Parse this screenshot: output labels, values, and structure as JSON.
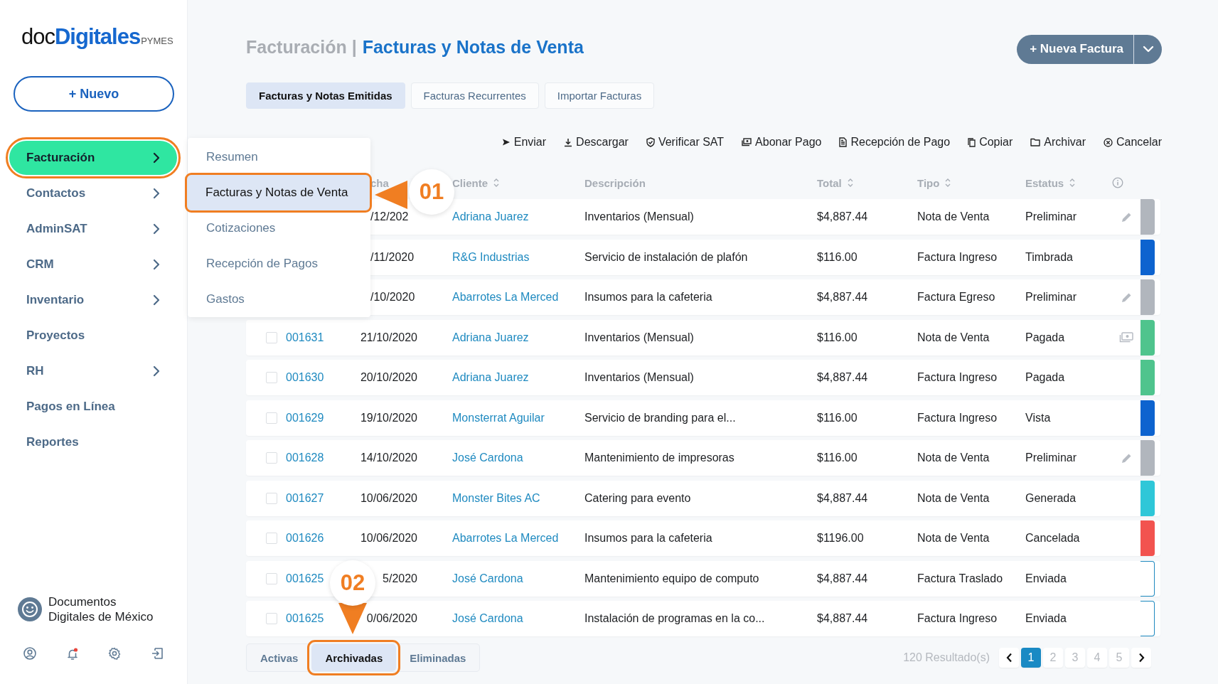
{
  "logo": {
    "prefix": "doc",
    "name": "Digitales",
    "suffix": "PYMES"
  },
  "new_button": {
    "label": "+ Nuevo"
  },
  "sidebar": {
    "items": [
      {
        "label": "Facturación",
        "selected": true,
        "highlighted": true,
        "submenu": true
      },
      {
        "label": "Contactos",
        "selected": false,
        "highlighted": false,
        "submenu": true
      },
      {
        "label": "AdminSAT",
        "selected": false,
        "highlighted": false,
        "submenu": true
      },
      {
        "label": "CRM",
        "selected": false,
        "highlighted": false,
        "submenu": true
      },
      {
        "label": "Inventario",
        "selected": false,
        "highlighted": false,
        "submenu": true
      },
      {
        "label": "Proyectos",
        "selected": false,
        "highlighted": false,
        "submenu": false
      },
      {
        "label": "RH",
        "selected": false,
        "highlighted": false,
        "submenu": true
      },
      {
        "label": "Pagos en Línea",
        "selected": false,
        "highlighted": false,
        "submenu": false
      },
      {
        "label": "Reportes",
        "selected": false,
        "highlighted": false,
        "submenu": false
      }
    ],
    "company": "Documentos Digitales de México",
    "footer_icons": [
      {
        "kind": "user"
      },
      {
        "kind": "bell",
        "alert": true
      },
      {
        "kind": "settings"
      },
      {
        "kind": "logout"
      }
    ]
  },
  "submenu": {
    "items": [
      {
        "label": "Resumen",
        "selected": false,
        "highlighted": false
      },
      {
        "label": "Facturas y Notas de Venta",
        "selected": true,
        "highlighted": true
      },
      {
        "label": "Cotizaciones",
        "selected": false,
        "highlighted": false
      },
      {
        "label": "Recepción de Pagos",
        "selected": false,
        "highlighted": false
      },
      {
        "label": "Gastos",
        "selected": false,
        "highlighted": false
      }
    ]
  },
  "header": {
    "section": "Facturación |",
    "page": "Facturas y Notas de Venta",
    "primary_button": "+ Nueva Factura"
  },
  "tabs": [
    {
      "label": "Facturas y Notas Emitidas",
      "selected": true
    },
    {
      "label": "Facturas Recurrentes",
      "selected": false
    },
    {
      "label": "Importar Facturas",
      "selected": false
    }
  ],
  "toolbar": [
    {
      "label": "Enviar",
      "kind": "send"
    },
    {
      "label": "Descargar",
      "kind": "download"
    },
    {
      "label": "Verificar SAT",
      "kind": "shield"
    },
    {
      "label": "Abonar Pago",
      "kind": "money"
    },
    {
      "label": "Recepción de Pago",
      "kind": "document"
    },
    {
      "label": "Copiar",
      "kind": "copy"
    },
    {
      "label": "Archivar",
      "kind": "folder"
    },
    {
      "label": "Cancelar",
      "kind": "cancel"
    }
  ],
  "table": {
    "columns": [
      {
        "label": "cha",
        "sortable": false,
        "covered": true
      },
      {
        "label": "Cliente",
        "sortable": true,
        "covered": false
      },
      {
        "label": "Descripción",
        "sortable": false,
        "covered": false
      },
      {
        "label": "Total",
        "sortable": true,
        "covered": false
      },
      {
        "label": "Tipo",
        "sortable": true,
        "covered": false
      },
      {
        "label": "Estatus",
        "sortable": true,
        "covered": false
      }
    ],
    "rows": [
      {
        "date": "/12/202",
        "client": "Adriana Juarez",
        "description": "Inventarios (Mensual)",
        "total": "$4,887.44",
        "type": "Nota de Venta",
        "status": "Preliminar",
        "kind": "editable",
        "color": "#b1b6bd",
        "outlined": false
      },
      {
        "date": "/11/2020",
        "client": "R&G Industrias",
        "description": "Servicio de instalación de plafón",
        "total": "$116.00",
        "type": "Factura Ingreso",
        "status": "Timbrada",
        "kind": "plain",
        "color": "#0d63cf",
        "outlined": false
      },
      {
        "date": "/10/2020",
        "client": "Abarrotes La Merced",
        "description": "Insumos para la cafeteria",
        "total": "$4,887.44",
        "type": "Factura Egreso",
        "status": "Preliminar",
        "kind": "editable",
        "color": "#b1b6bd",
        "outlined": false
      },
      {
        "folio": "001631",
        "checked": false,
        "date": "21/10/2020",
        "client": "Adriana Juarez",
        "description": "Inventarios (Mensual)",
        "total": "$116.00",
        "type": "Nota de Venta",
        "status": "Pagada",
        "kind": "paid",
        "color": "#4fc48d",
        "outlined": false
      },
      {
        "folio": "001630",
        "checked": false,
        "date": "20/10/2020",
        "client": "Adriana Juarez",
        "description": "Inventarios (Mensual)",
        "total": "$4,887.44",
        "type": "Factura Ingreso",
        "status": "Pagada",
        "kind": "plain",
        "color": "#4fc48d",
        "outlined": false
      },
      {
        "folio": "001629",
        "checked": false,
        "date": "19/10/2020",
        "client": "Monsterrat Aguilar",
        "description": "Servicio de branding para el...",
        "total": "$116.00",
        "type": "Factura Ingreso",
        "status": "Vista",
        "kind": "plain",
        "color": "#0d63cf",
        "outlined": false
      },
      {
        "folio": "001628",
        "checked": false,
        "date": "14/10/2020",
        "client": "José Cardona",
        "description": "Mantenimiento de impresoras",
        "total": "$116.00",
        "type": "Nota de Venta",
        "status": "Preliminar",
        "kind": "editable",
        "color": "#b1b6bd",
        "outlined": false
      },
      {
        "folio": "001627",
        "checked": false,
        "date": "10/06/2020",
        "client": "Monster Bites AC",
        "description": "Catering para evento",
        "total": "$4,887.44",
        "type": "Nota de Venta",
        "status": "Generada",
        "kind": "plain",
        "color": "#2fc7d8",
        "outlined": false
      },
      {
        "folio": "001626",
        "checked": false,
        "date": "10/06/2020",
        "client": "Abarrotes La Merced",
        "description": "Insumos para la cafeteria",
        "total": "$1196.00",
        "type": "Nota de Venta",
        "status": "Cancelada",
        "kind": "plain",
        "color": "#f2534f",
        "outlined": false
      },
      {
        "folio": "001625",
        "checked": false,
        "date": "5/2020",
        "client": "José Cardona",
        "description": "Mantenimiento equipo de computo",
        "total": "$4,887.44",
        "type": "Factura Traslado",
        "status": "Enviada",
        "kind": "plain",
        "color": "#1f8ac0",
        "outlined": true
      },
      {
        "folio": "001625",
        "checked": false,
        "date": "0/06/2020",
        "client": "José Cardona",
        "description": "Instalación de programas en la co...",
        "total": "$4,887.44",
        "type": "Factura Ingreso",
        "status": "Enviada",
        "kind": "plain",
        "color": "#1f8ac0",
        "outlined": true
      }
    ]
  },
  "filters": [
    {
      "label": "Activas",
      "selected": false,
      "highlighted": false
    },
    {
      "label": "Archivadas",
      "selected": true,
      "highlighted": true
    },
    {
      "label": "Eliminadas",
      "selected": false,
      "highlighted": false
    }
  ],
  "pagination": {
    "results": "120 Resultado(s)",
    "pages": [
      {
        "label": "1",
        "selected": true
      },
      {
        "label": "2",
        "selected": false
      },
      {
        "label": "3",
        "selected": false
      },
      {
        "label": "4",
        "selected": false
      },
      {
        "label": "5",
        "selected": false
      }
    ]
  },
  "callouts": [
    {
      "label": "01",
      "kind": "left"
    },
    {
      "label": "02",
      "kind": "down"
    }
  ]
}
